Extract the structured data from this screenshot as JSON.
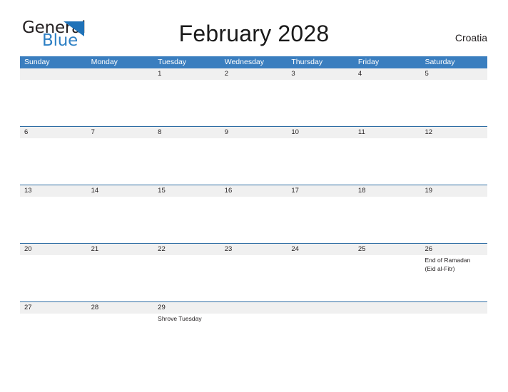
{
  "brand": {
    "word_one": "General",
    "word_two": "Blue",
    "triangle_icon": "triangle-icon",
    "accent_blue": "#2c7fc4",
    "dark": "#231f20"
  },
  "header": {
    "title": "February 2028",
    "country": "Croatia"
  },
  "calendar": {
    "header_bg": "#3a7ebf",
    "band_bg": "#f0f0f0",
    "rule_color": "#2e6da4",
    "weekdays": [
      "Sunday",
      "Monday",
      "Tuesday",
      "Wednesday",
      "Thursday",
      "Friday",
      "Saturday"
    ],
    "weeks": [
      [
        {
          "day": "",
          "events": []
        },
        {
          "day": "",
          "events": []
        },
        {
          "day": "1",
          "events": []
        },
        {
          "day": "2",
          "events": []
        },
        {
          "day": "3",
          "events": []
        },
        {
          "day": "4",
          "events": []
        },
        {
          "day": "5",
          "events": []
        }
      ],
      [
        {
          "day": "6",
          "events": []
        },
        {
          "day": "7",
          "events": []
        },
        {
          "day": "8",
          "events": []
        },
        {
          "day": "9",
          "events": []
        },
        {
          "day": "10",
          "events": []
        },
        {
          "day": "11",
          "events": []
        },
        {
          "day": "12",
          "events": []
        }
      ],
      [
        {
          "day": "13",
          "events": []
        },
        {
          "day": "14",
          "events": []
        },
        {
          "day": "15",
          "events": []
        },
        {
          "day": "16",
          "events": []
        },
        {
          "day": "17",
          "events": []
        },
        {
          "day": "18",
          "events": []
        },
        {
          "day": "19",
          "events": []
        }
      ],
      [
        {
          "day": "20",
          "events": []
        },
        {
          "day": "21",
          "events": []
        },
        {
          "day": "22",
          "events": []
        },
        {
          "day": "23",
          "events": []
        },
        {
          "day": "24",
          "events": []
        },
        {
          "day": "25",
          "events": []
        },
        {
          "day": "26",
          "events": [
            "End of Ramadan",
            "(Eid al-Fitr)"
          ]
        }
      ],
      [
        {
          "day": "27",
          "events": []
        },
        {
          "day": "28",
          "events": []
        },
        {
          "day": "29",
          "events": [
            "Shrove Tuesday"
          ]
        },
        {
          "day": "",
          "events": []
        },
        {
          "day": "",
          "events": []
        },
        {
          "day": "",
          "events": []
        },
        {
          "day": "",
          "events": []
        }
      ]
    ]
  }
}
